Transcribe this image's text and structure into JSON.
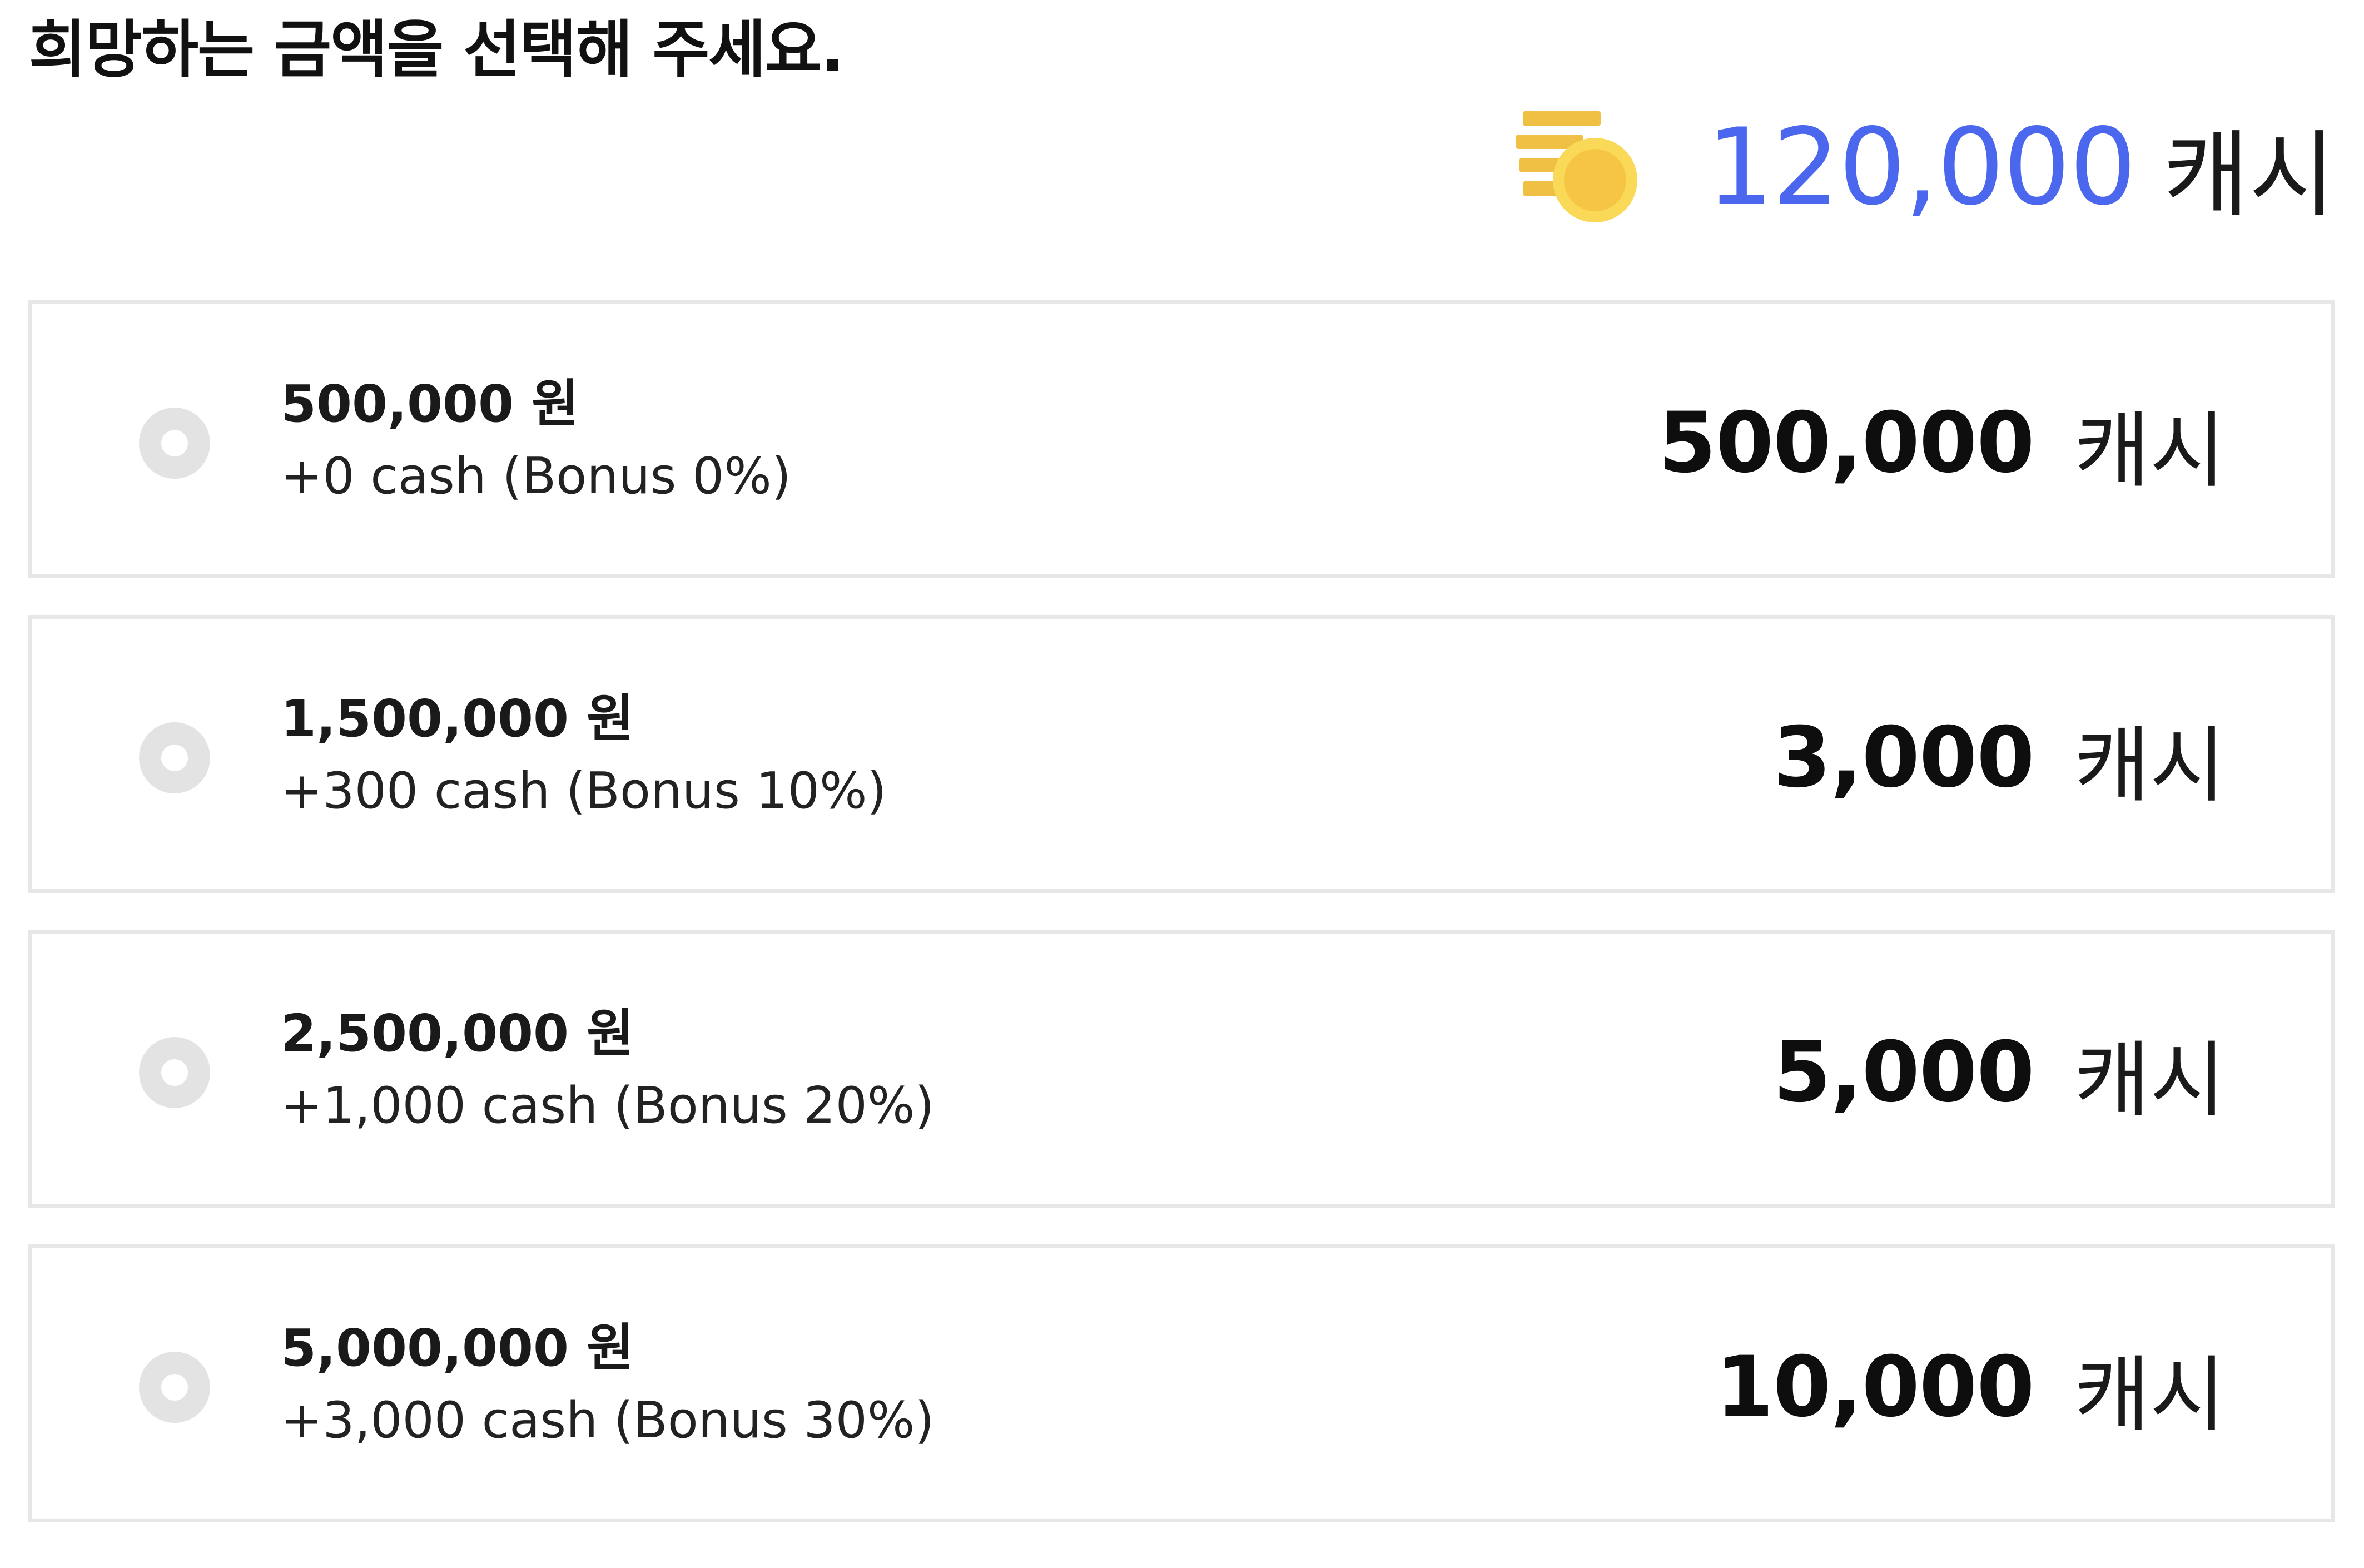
{
  "title": "희망하는 금액을 선택해 주세요.",
  "balance": {
    "icon": "coin-stack-icon",
    "amount": "120,000",
    "unit": "캐시",
    "amount_color": "#4a67ee",
    "icon_color": "#f5c543"
  },
  "options": [
    {
      "price": "500,000 원",
      "bonus": "+0 cash (Bonus 0%)",
      "cash_amount": "500,000",
      "cash_unit": "캐시",
      "selected": false
    },
    {
      "price": "1,500,000 원",
      "bonus": "+300 cash (Bonus 10%)",
      "cash_amount": "3,000",
      "cash_unit": "캐시",
      "selected": false
    },
    {
      "price": "2,500,000 원",
      "bonus": "+1,000 cash (Bonus 20%)",
      "cash_amount": "5,000",
      "cash_unit": "캐시",
      "selected": false
    },
    {
      "price": "5,000,000 원",
      "bonus": "+3,000 cash (Bonus 30%)",
      "cash_amount": "10,000",
      "cash_unit": "캐시",
      "selected": false
    }
  ]
}
